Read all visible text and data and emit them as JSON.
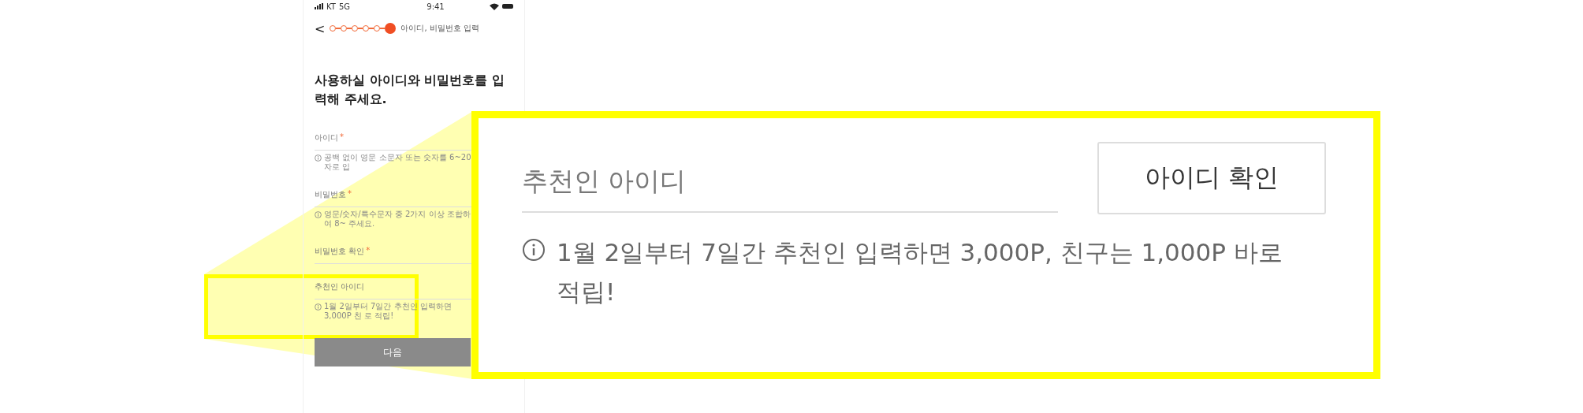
{
  "status_bar": {
    "carrier": "KT",
    "network": "5G",
    "time": "9:41"
  },
  "header": {
    "back": "<",
    "step_label": "아이디, 비밀번호 입력",
    "steps": [
      {
        "selected": false
      },
      {
        "selected": false
      },
      {
        "selected": false
      },
      {
        "selected": false
      },
      {
        "selected": false
      },
      {
        "selected": true
      }
    ]
  },
  "title": "사용하실 아이디와 비밀번호를 입력해 주세요.",
  "fields": [
    {
      "label": "아이디",
      "required_mark": "*",
      "hint": "공백 없이 영문 소문자 또는 숫자를 6~20자로 입"
    },
    {
      "label": "비밀번호",
      "required_mark": "*",
      "hint": "영문/숫자/특수문자 중 2가지 이상 조합하여 8~ 주세요."
    },
    {
      "label": "비밀번호 확인",
      "required_mark": "*"
    },
    {
      "label": "추천인 아이디",
      "hint": "1월 2일부터 7일간 추천인 입력하면 3,000P 친 로 적립!"
    }
  ],
  "next_button": "다음",
  "callout": {
    "placeholder": "추천인 아이디",
    "button": "아이디 확인",
    "info": "1월 2일부터 7일간 추천인 입력하면 3,000P, 친구는 1,000P 바로 적립!"
  }
}
